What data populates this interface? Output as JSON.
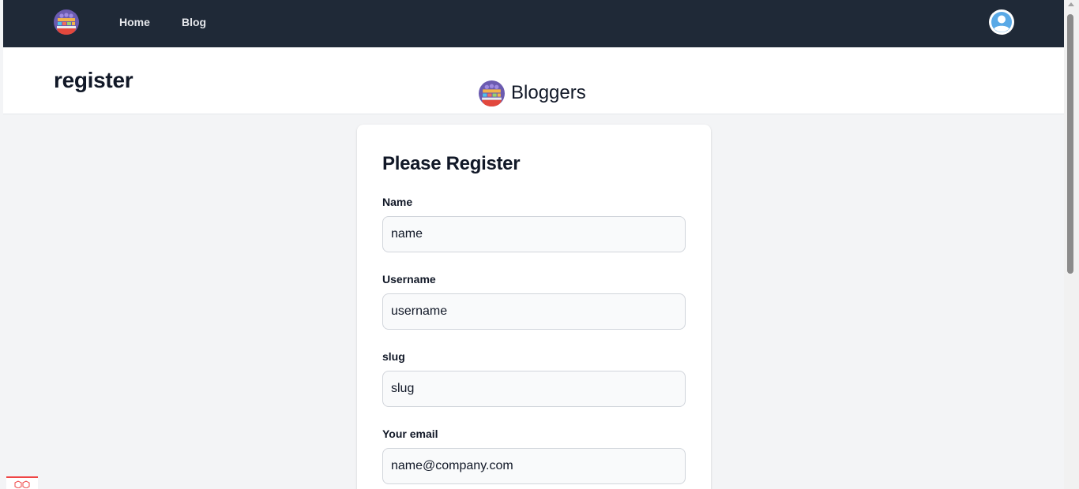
{
  "nav": {
    "logo_icon": "bookshelf-logo-icon",
    "links": [
      "Home",
      "Blog"
    ],
    "avatar_icon": "user-avatar-icon"
  },
  "header": {
    "title": "register",
    "brand_name": "Bloggers",
    "brand_icon": "bookshelf-logo-icon"
  },
  "form": {
    "title": "Please Register",
    "fields": [
      {
        "label": "Name",
        "placeholder": "name"
      },
      {
        "label": "Username",
        "placeholder": "username"
      },
      {
        "label": "slug",
        "placeholder": "slug"
      },
      {
        "label": "Your email",
        "placeholder": "name@company.com"
      }
    ]
  },
  "colors": {
    "navbar_bg": "#1f2937",
    "page_bg": "#f3f4f6",
    "input_bg": "#f9fafb",
    "input_border": "#d1d5db",
    "widget_accent": "#ef4444"
  }
}
